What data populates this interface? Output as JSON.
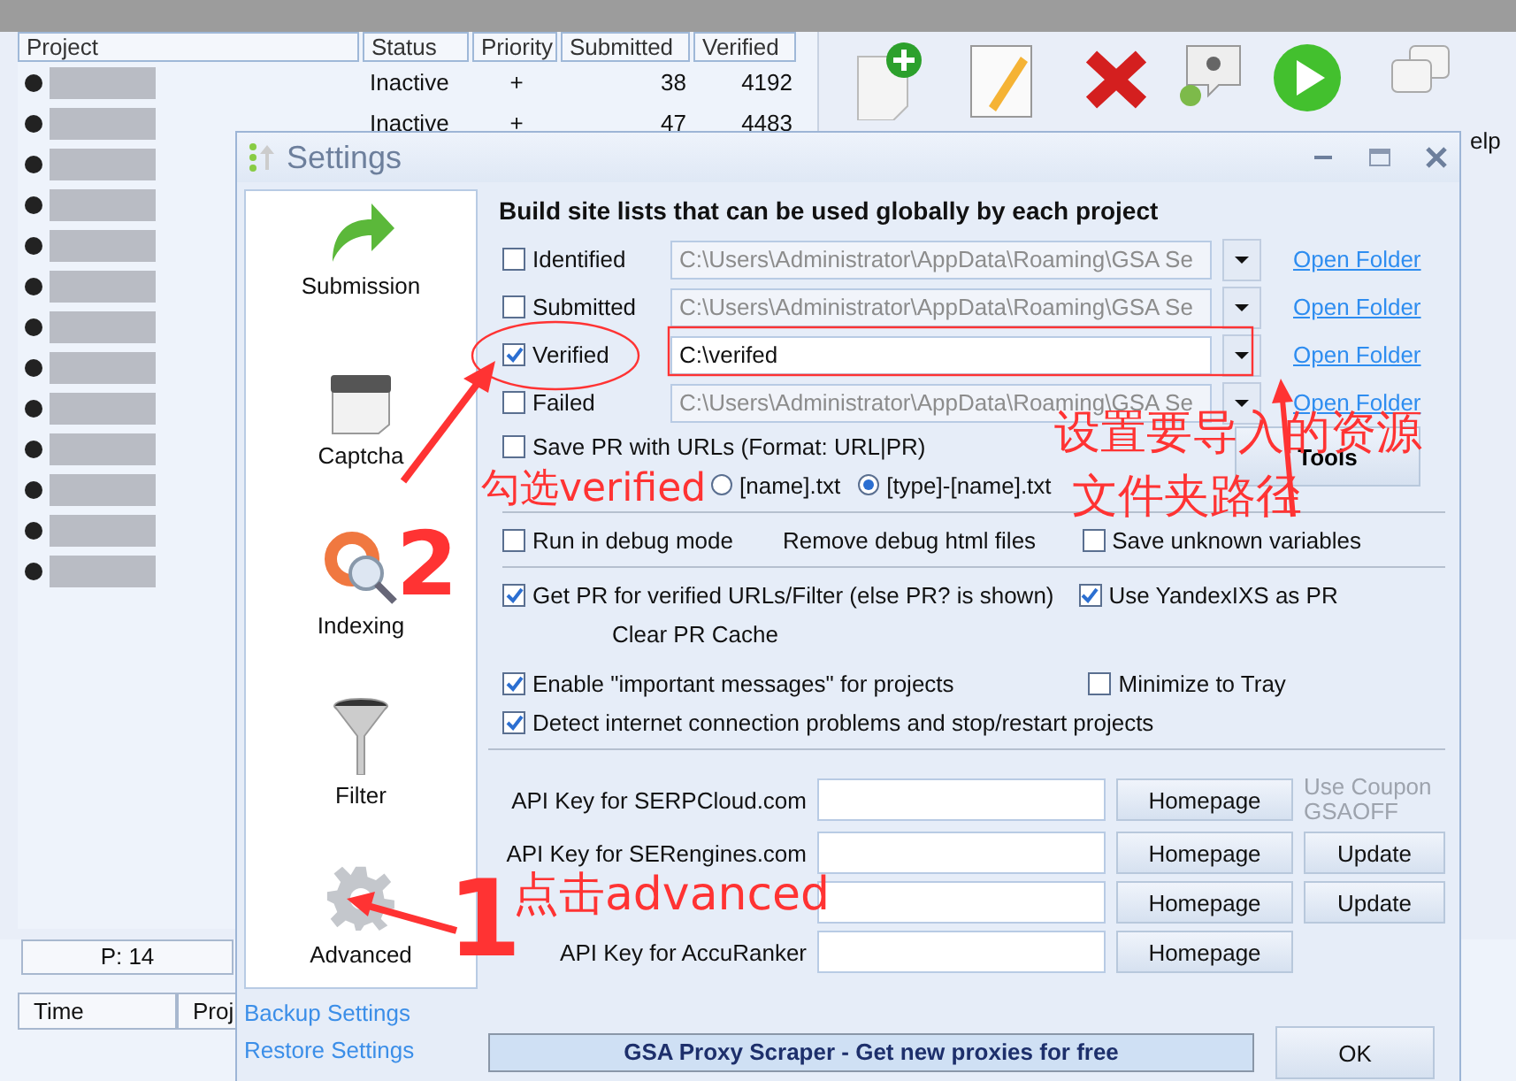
{
  "main_window": {
    "columns": [
      "Project",
      "Status",
      "Priority",
      "Submitted",
      "Verified"
    ],
    "rows": [
      {
        "status": "Inactive",
        "priority": "+",
        "submitted": "38",
        "verified": "4192"
      },
      {
        "status": "Inactive",
        "priority": "+",
        "submitted": "47",
        "verified": "4483"
      }
    ],
    "toolbar": {
      "help_label": "elp"
    },
    "status_bar": {
      "count": "P: 14"
    },
    "log_columns": [
      "Time",
      "Proj"
    ]
  },
  "dialog": {
    "title": "Settings",
    "sidebar": [
      {
        "label": "Submission",
        "kind": "arrow"
      },
      {
        "label": "Captcha",
        "kind": "captcha"
      },
      {
        "label": "Indexing",
        "kind": "indexing"
      },
      {
        "label": "Filter",
        "kind": "filter"
      },
      {
        "label": "Advanced",
        "kind": "gear"
      }
    ],
    "links": [
      "Backup Settings",
      "Restore Settings"
    ],
    "heading": "Build site lists that can be used globally by each project",
    "site_lists": [
      {
        "label": "Identified",
        "checked": false,
        "path": "C:\\Users\\Administrator\\AppData\\Roaming\\GSA Se",
        "disabled": true,
        "link": "Open Folder"
      },
      {
        "label": "Submitted",
        "checked": false,
        "path": "C:\\Users\\Administrator\\AppData\\Roaming\\GSA Se",
        "disabled": true,
        "link": "Open Folder"
      },
      {
        "label": "Verified",
        "checked": true,
        "path": "C:\\verifed",
        "disabled": false,
        "link": "Open Folder"
      },
      {
        "label": "Failed",
        "checked": false,
        "path": "C:\\Users\\Administrator\\AppData\\Roaming\\GSA Se",
        "disabled": true,
        "link": "Open Folder"
      }
    ],
    "save_pr": {
      "label": "Save PR with URLs (Format: URL|PR)",
      "checked": false
    },
    "file_format": [
      {
        "label": "[name].txt",
        "selected": false
      },
      {
        "label": "[type]-[name].txt",
        "selected": true
      }
    ],
    "tools_button": "Tools",
    "debug": {
      "label": "Run in debug mode",
      "checked": false
    },
    "remove_debug_button": "Remove debug html files",
    "save_unknown": {
      "label": "Save unknown variables",
      "checked": false
    },
    "get_pr": {
      "label": "Get PR for verified URLs/Filter  (else PR? is shown)",
      "checked": true
    },
    "use_yandex": {
      "label": "Use YandexIXS as PR",
      "checked": true
    },
    "clear_pr_button": "Clear PR Cache",
    "important_messages": {
      "label": "Enable \"important messages\" for projects",
      "checked": true
    },
    "minimize_tray": {
      "label": "Minimize to Tray",
      "checked": false
    },
    "detect_internet": {
      "label": "Detect internet connection problems and stop/restart projects",
      "checked": true
    },
    "api_keys": [
      {
        "label": "API Key for SERPCloud.com",
        "homepage": "Homepage",
        "note": "Use Coupon GSAOFF"
      },
      {
        "label": "API Key for SERengines.com",
        "homepage": "Homepage",
        "update": "Update"
      },
      {
        "homepage": "Homepage",
        "update": "Update"
      },
      {
        "label": "API Key for AccuRanker",
        "homepage": "Homepage"
      }
    ],
    "banner": "GSA Proxy Scraper - Get new proxies for free",
    "ok_button": "OK"
  },
  "annotations": [
    {
      "kind": "step",
      "text": "2"
    },
    {
      "kind": "note",
      "text": "勾选verified"
    },
    {
      "kind": "note",
      "text": "设置要导入的资源"
    },
    {
      "kind": "note",
      "text": "文件夹路径"
    },
    {
      "kind": "step",
      "text": "1"
    },
    {
      "kind": "note",
      "text": "点击advanced"
    }
  ]
}
